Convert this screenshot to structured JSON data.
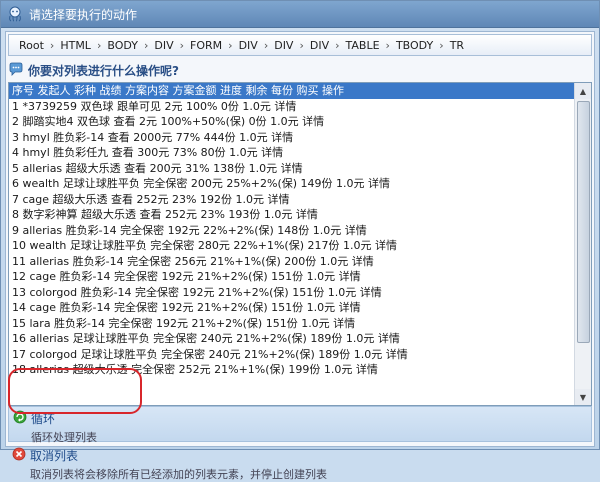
{
  "window": {
    "title": "请选择要执行的动作"
  },
  "breadcrumb": [
    "Root",
    "HTML",
    "BODY",
    "DIV",
    "FORM",
    "DIV",
    "DIV",
    "DIV",
    "TABLE",
    "TBODY",
    "TR"
  ],
  "question": "你要对列表进行什么操作呢?",
  "list": {
    "header": "序号 发起人 彩种 战绩 方案内容 方案金额 进度 剩余 每份 购买 操作",
    "rows": [
      "1 *3739259 双色球 跟单可见 2元 100% 0份 1.0元 详情",
      "2 脚踏实地4 双色球 查看 2元 100%+50%(保) 0份 1.0元 详情",
      "3 hmyl 胜负彩-14 查看 2000元 77% 444份 1.0元 详情",
      "4 hmyl 胜负彩任九 查看 300元 73% 80份 1.0元 详情",
      "5 allerias 超级大乐透 查看 200元 31% 138份 1.0元 详情",
      "6 wealth 足球让球胜平负 完全保密 200元 25%+2%(保) 149份 1.0元 详情",
      "7 cage 超级大乐透 查看 252元 23% 192份 1.0元 详情",
      "8 数字彩神算 超级大乐透 查看 252元 23% 193份 1.0元 详情",
      "9 allerias 胜负彩-14 完全保密 192元 22%+2%(保) 148份 1.0元 详情",
      "10 wealth 足球让球胜平负 完全保密 280元 22%+1%(保) 217份 1.0元 详情",
      "11 allerias 胜负彩-14 完全保密 256元 21%+1%(保) 200份 1.0元 详情",
      "12 cage 胜负彩-14 完全保密 192元 21%+2%(保) 151份 1.0元 详情",
      "13 colorgod 胜负彩-14 完全保密 192元 21%+2%(保) 151份 1.0元 详情",
      "14 cage 胜负彩-14 完全保密 192元 21%+2%(保) 151份 1.0元 详情",
      "15 lara 胜负彩-14 完全保密 192元 21%+2%(保) 151份 1.0元 详情",
      "16 allerias 足球让球胜平负 完全保密 240元 21%+2%(保) 189份 1.0元 详情",
      "17 colorgod 足球让球胜平负 完全保密 240元 21%+2%(保) 189份 1.0元 详情",
      "18 allerias 超级大乐透 完全保密 252元 21%+1%(保) 199份 1.0元 详情"
    ]
  },
  "options": {
    "loop": {
      "title": "循环",
      "desc": "循环处理列表"
    },
    "cancel": {
      "title": "取消列表",
      "desc": "取消列表将会移除所有已经添加的列表元素，并停止创建列表"
    }
  },
  "colors": {
    "selection": "#3a78c8",
    "highlight": "#d8262b",
    "accent": "#1f4b8a"
  }
}
